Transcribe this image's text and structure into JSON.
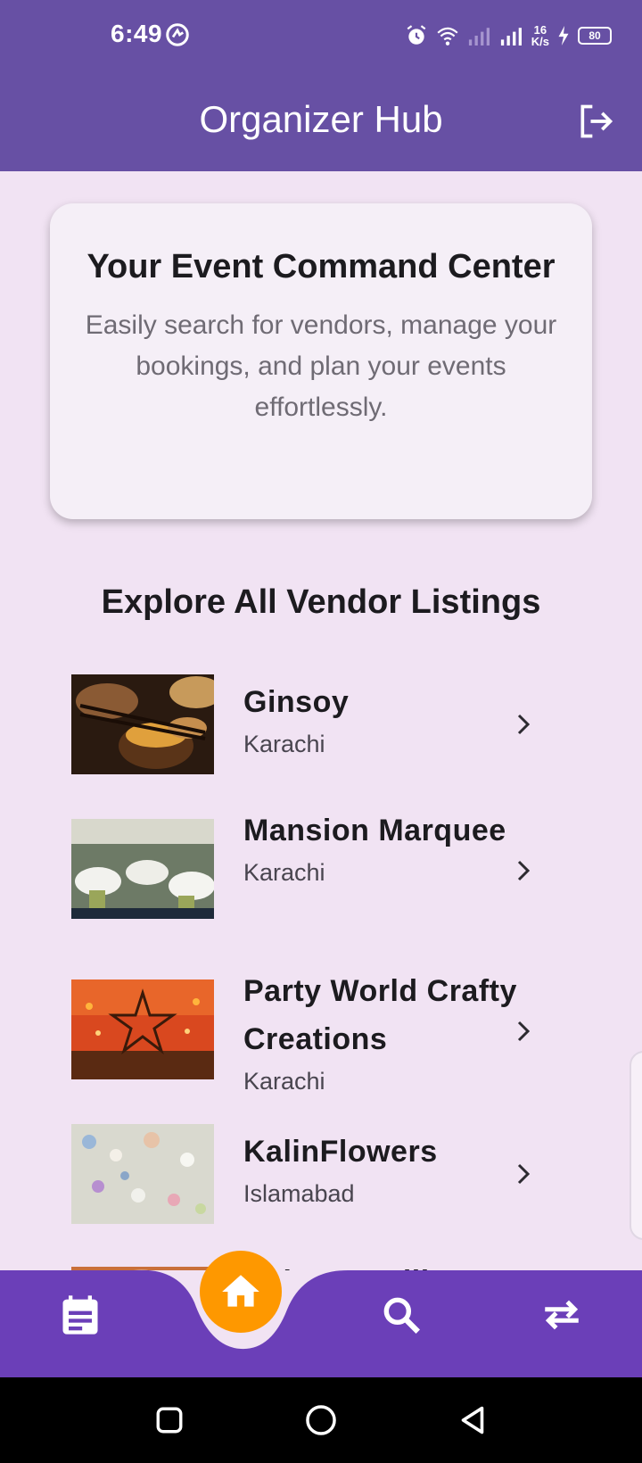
{
  "status_bar": {
    "time": "6:49",
    "network_speed_value": "16",
    "network_speed_unit": "K/s",
    "battery": "80"
  },
  "app_bar": {
    "title": "Organizer Hub"
  },
  "hero": {
    "title": "Your Event Command Center",
    "description": "Easily search for vendors, manage your bookings, and plan your events effortlessly."
  },
  "section": {
    "title": "Explore All Vendor Listings"
  },
  "vendors": [
    {
      "name": "Ginsoy",
      "location": "Karachi"
    },
    {
      "name": "Mansion Marquee",
      "location": "Karachi"
    },
    {
      "name": "Party World Crafty Creations",
      "location": "Karachi"
    },
    {
      "name": "KalinFlowers",
      "location": "Islamabad"
    },
    {
      "name": "Spice & Grill",
      "location": ""
    }
  ],
  "bottom_nav": {
    "items": [
      "calendar-icon",
      "home-icon",
      "search-icon",
      "swap-icon"
    ],
    "active": "home",
    "accent": "#fe9800",
    "bar_color": "#6b3fb8"
  },
  "colors": {
    "primary": "#6750a4",
    "background": "#f1e3f3",
    "card": "#f5eff7"
  }
}
